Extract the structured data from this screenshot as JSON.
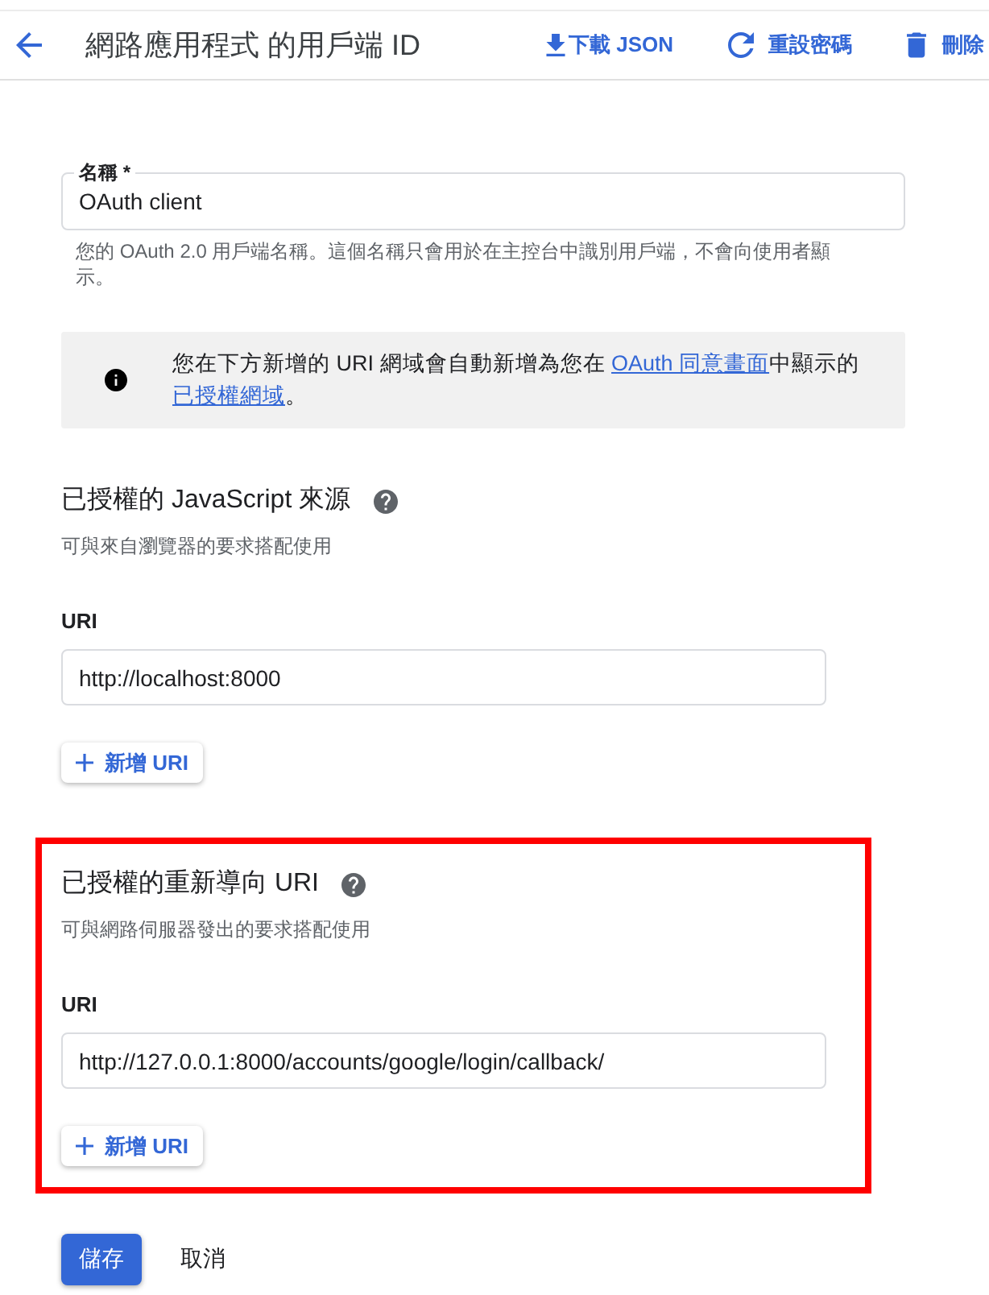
{
  "header": {
    "title": "網路應用程式 的用戶端 ID",
    "actions": [
      {
        "kind": "download",
        "label": "下載 JSON"
      },
      {
        "kind": "reset",
        "label": "重設密碼"
      },
      {
        "kind": "delete",
        "label": "刪除"
      }
    ]
  },
  "name_field": {
    "label": "名稱 *",
    "value": "OAuth client",
    "helper": "您的 OAuth 2.0 用戶端名稱。這個名稱只會用於在主控台中識別用戶端，不會向使用者顯示。"
  },
  "info_banner": {
    "parts": [
      {
        "kind": "text",
        "text": "您在下方新增的 URI 網域會自動新增為您在 "
      },
      {
        "kind": "link",
        "text": "OAuth 同意畫面"
      },
      {
        "kind": "text",
        "text": "中顯示的"
      },
      {
        "kind": "link",
        "text": "已授權網域"
      },
      {
        "kind": "text",
        "text": "。"
      }
    ]
  },
  "sections": [
    {
      "title": "已授權的 JavaScript 來源",
      "subtitle": "可與來自瀏覽器的要求搭配使用",
      "field_label": "URI",
      "value": "http://localhost:8000",
      "add_button": "新增 URI",
      "highlighted": false
    },
    {
      "title": "已授權的重新導向 URI",
      "subtitle": "可與網路伺服器發出的要求搭配使用",
      "field_label": "URI",
      "value": "http://127.0.0.1:8000/accounts/google/login/callback/",
      "add_button": "新增 URI",
      "highlighted": true
    }
  ],
  "footer": {
    "buttons": [
      {
        "kind": "primary",
        "label": "儲存"
      },
      {
        "kind": "text",
        "label": "取消"
      }
    ]
  }
}
